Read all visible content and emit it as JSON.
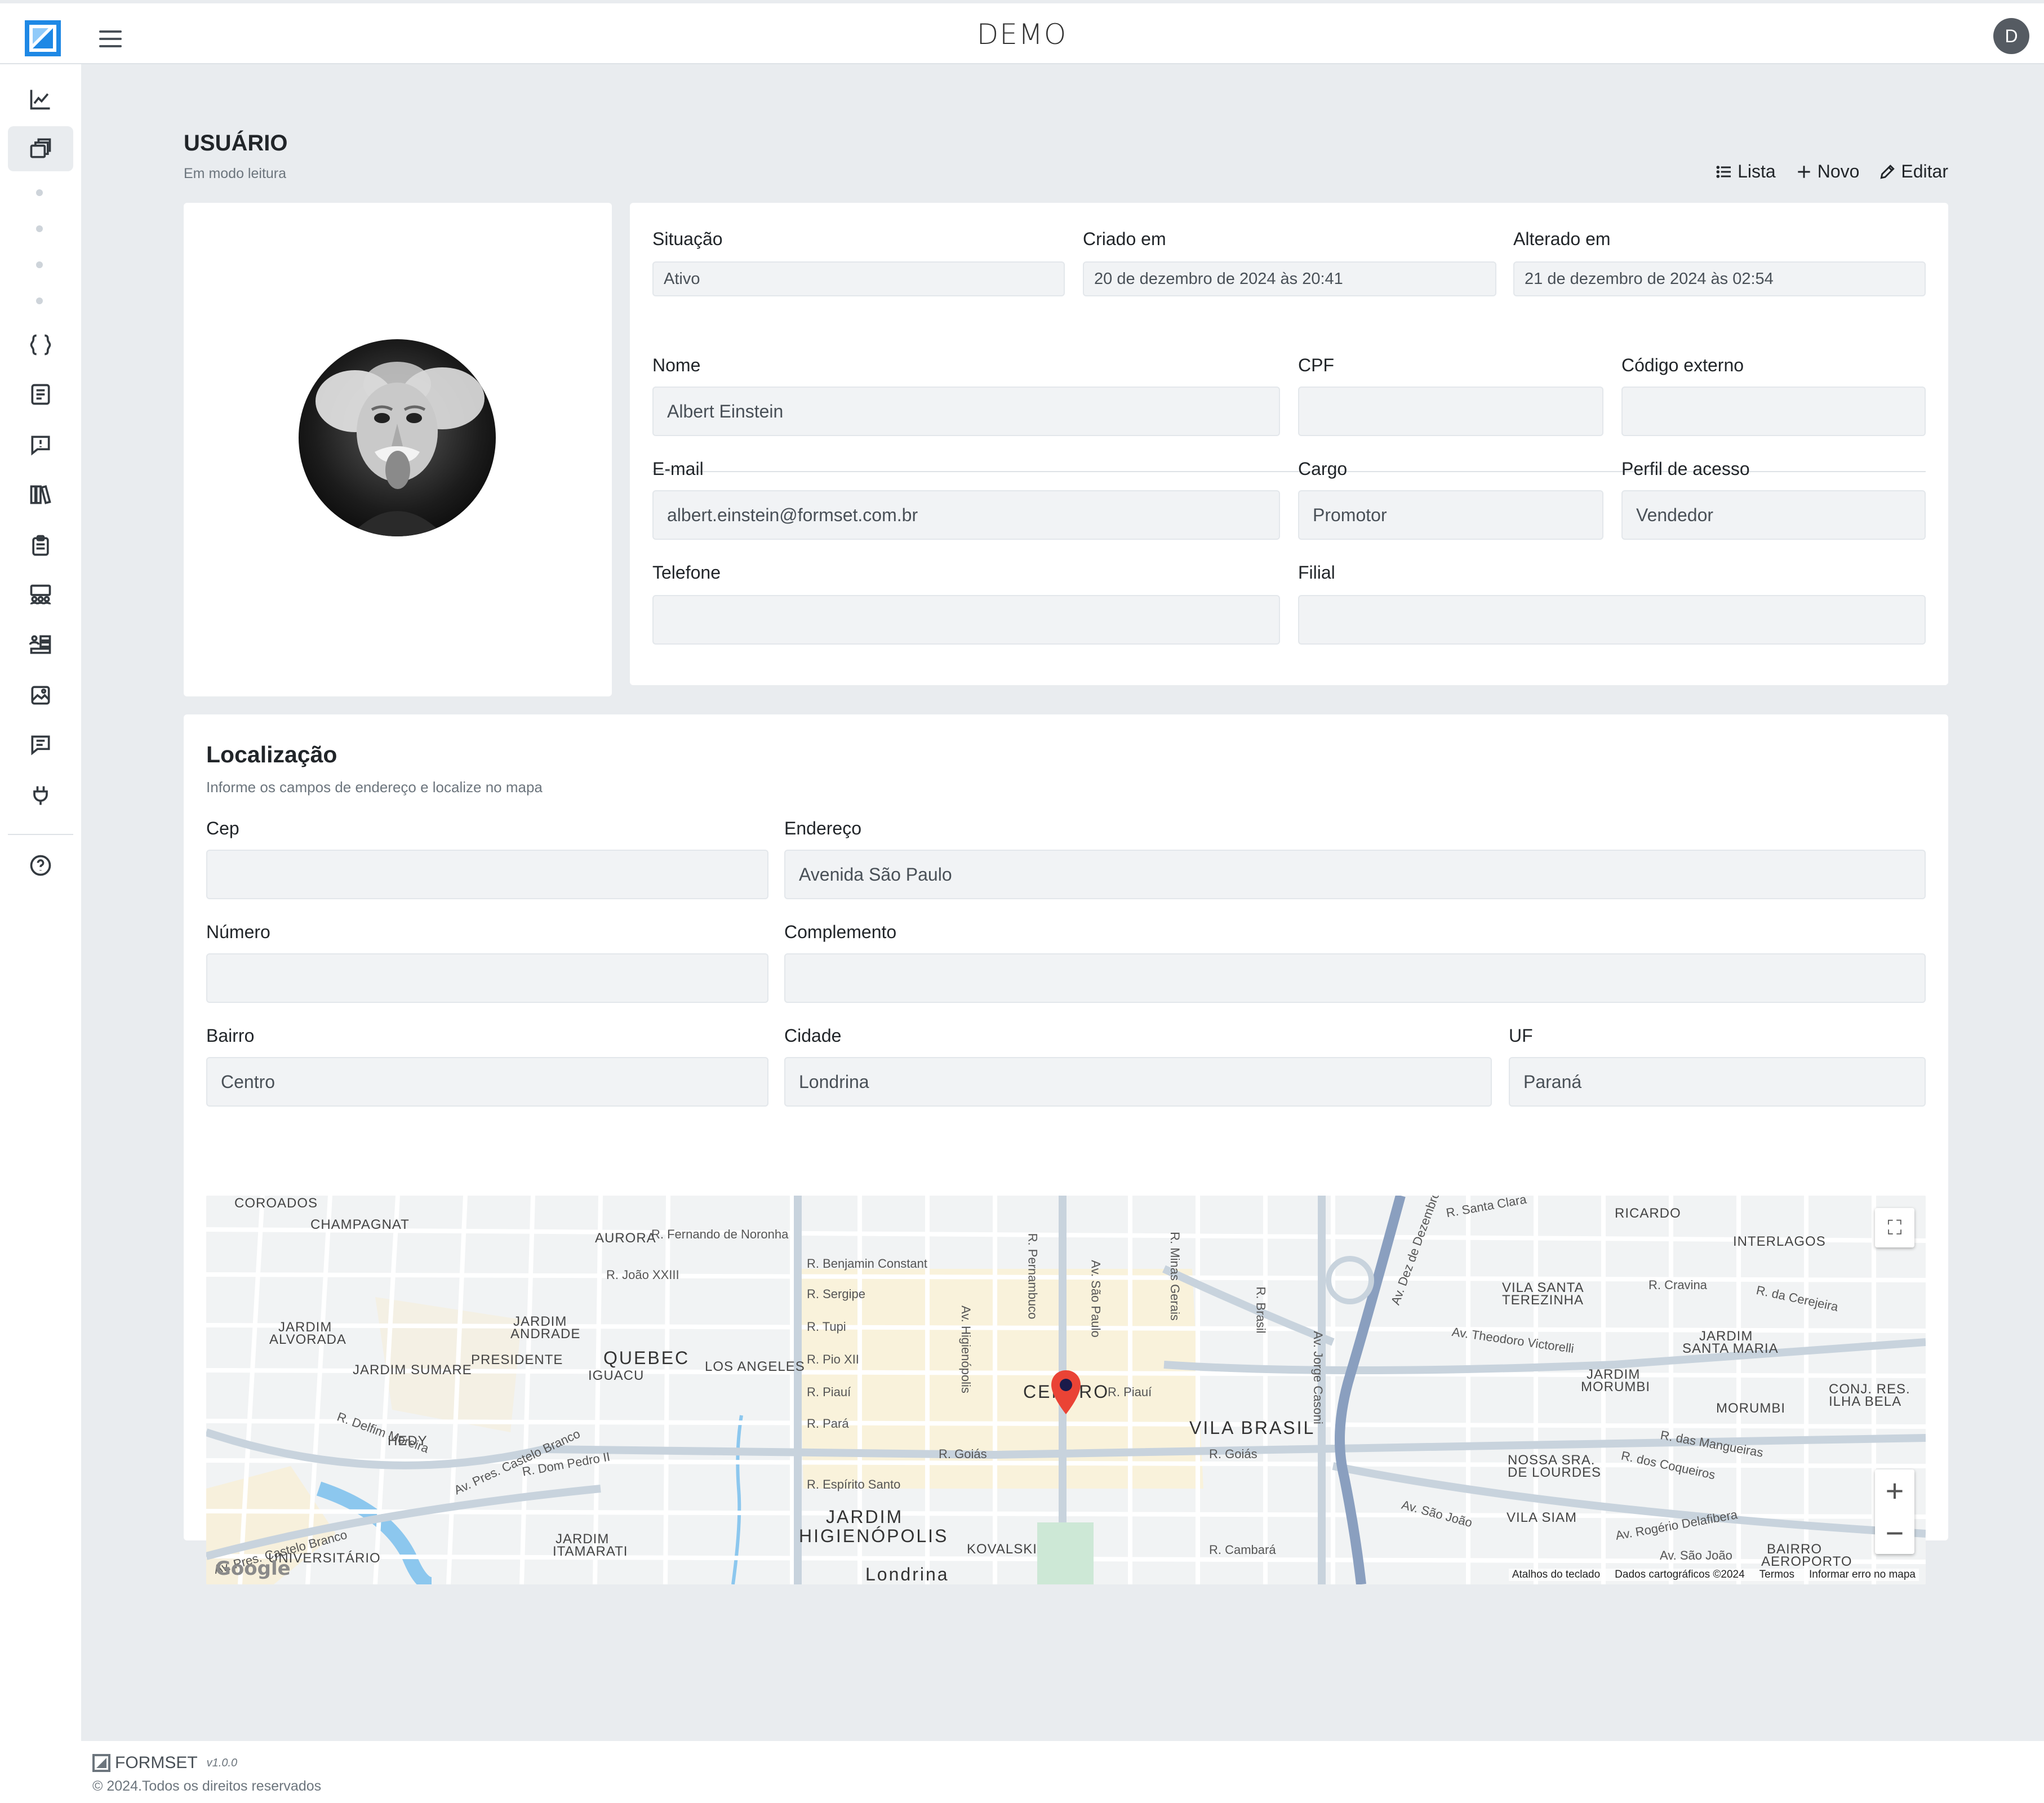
{
  "header": {
    "title": "DEMO",
    "avatar_initial": "D"
  },
  "sidebar": {
    "items": [
      {
        "name": "dashboard-chart-icon"
      },
      {
        "name": "forms-stack-icon"
      },
      {
        "name": "code-braces-icon"
      },
      {
        "name": "checklist-icon"
      },
      {
        "name": "alert-message-icon"
      },
      {
        "name": "library-icon"
      },
      {
        "name": "clipboard-icon"
      },
      {
        "name": "team-board-icon"
      },
      {
        "name": "users-list-icon"
      },
      {
        "name": "image-gallery-icon"
      },
      {
        "name": "chat-icon"
      },
      {
        "name": "plug-icon"
      },
      {
        "name": "help-circle-icon"
      }
    ]
  },
  "page": {
    "title": "USUÁRIO",
    "subtitle": "Em modo leitura"
  },
  "actions": {
    "list_label": "Lista",
    "new_label": "Novo",
    "edit_label": "Editar"
  },
  "info": {
    "situacao_label": "Situação",
    "situacao_value": "Ativo",
    "criado_label": "Criado em",
    "criado_value": "20 de dezembro de 2024 às 20:41",
    "alterado_label": "Alterado em",
    "alterado_value": "21 de dezembro de 2024 às 02:54",
    "nome_label": "Nome",
    "nome_value": "Albert Einstein",
    "cpf_label": "CPF",
    "cpf_value": "",
    "codigo_label": "Código externo",
    "codigo_value": "",
    "email_label": "E-mail",
    "email_value": "albert.einstein@formset.com.br",
    "cargo_label": "Cargo",
    "cargo_value": "Promotor",
    "perfil_label": "Perfil de acesso",
    "perfil_value": "Vendedor",
    "telefone_label": "Telefone",
    "telefone_value": "",
    "filial_label": "Filial",
    "filial_value": ""
  },
  "location": {
    "title": "Localização",
    "subtitle": "Informe os campos de endereço e localize no mapa",
    "cep_label": "Cep",
    "cep_value": "",
    "endereco_label": "Endereço",
    "endereco_value": "Avenida São Paulo",
    "numero_label": "Número",
    "numero_value": "",
    "complemento_label": "Complemento",
    "complemento_value": "",
    "bairro_label": "Bairro",
    "bairro_value": "Centro",
    "cidade_label": "Cidade",
    "cidade_value": "Londrina",
    "uf_label": "UF",
    "uf_value": "Paraná"
  },
  "map": {
    "labels": [
      "COROADOS",
      "CHAMPAGNAT",
      "AURORA",
      "R. Fernando de Noronha",
      "R. Benjamin Constant",
      "R. Sergipe",
      "R. Tupi",
      "R. Pio XII",
      "R. Piauí",
      "R. Pará",
      "R. Espírito Santo",
      "R. Goiás",
      "R. João XXIII",
      "QUEBEC",
      "IGUACU",
      "LOS ANGELES",
      "PRESIDENTE",
      "JARDIM ANDRADE",
      "JARDIM ALVORADA",
      "JARDIM SUMARE",
      "HEDY",
      "R. Delfim Moreira",
      "Av. Pres. Castelo Branco",
      "R. Dom Pedro II",
      "JARDIM ITAMARATI",
      "UNIVERSITÁRIO",
      "JARDIM",
      "HIGIENÓPOLIS",
      "KOVALSKI",
      "Londrina",
      "CENTRO",
      "VILA BRASIL",
      "Av. Theodoro Victorelli",
      "VILA SANTA TEREZINHA",
      "R. Cravina",
      "R. da Cerejeira",
      "INTERLAGOS",
      "RICARDO",
      "R. Santa Clara",
      "JARDIM SANTA MARIA",
      "JARDIM MORUMBI",
      "MORUMBI",
      "CONJ. RES. ILHA BELA",
      "NOSSA SRA. DE LOURDES",
      "R. das Mangueiras",
      "R. dos Coqueiros",
      "VILA SIAM",
      "Av. São João",
      "Av. Rogério Delafibera",
      "BAIRRO AEROPORTO",
      "R. Cambará",
      "Av. São Paulo",
      "Av. Higienópolis",
      "R. Pernambuco",
      "R. Minas Gerais",
      "R. Brasil",
      "Av. Jorge Casoni",
      "Av. Dez de Dezembro"
    ],
    "attribution": "Google",
    "footer_links": [
      "Atalhos do teclado",
      "Dados cartográficos ©2024",
      "Termos",
      "Informar erro no mapa"
    ],
    "zoom_in": "+",
    "zoom_out": "−"
  },
  "footer": {
    "brand": "FORMSET",
    "version": "v1.0.0",
    "copyright": "© 2024.Todos os direitos reservados"
  }
}
